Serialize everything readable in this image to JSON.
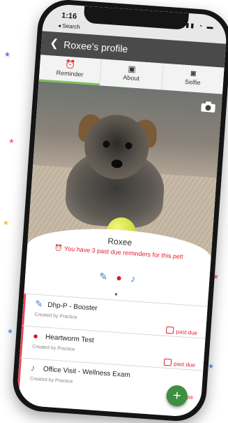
{
  "status_bar": {
    "time": "1:16",
    "back_hint": "◂ Search",
    "icons": "▮▮▮ ◔ ▬"
  },
  "header": {
    "back_icon": "chevron-left",
    "title": "Roxee's profile"
  },
  "tabs": [
    {
      "label": "Reminder",
      "icon": "alarm-clock",
      "active": true
    },
    {
      "label": "About",
      "icon": "id-card",
      "active": false
    },
    {
      "label": "Selfie",
      "icon": "camera",
      "active": false
    }
  ],
  "pet": {
    "name": "Roxee",
    "alert": "You have 3 past due reminders for this pet!"
  },
  "reminders": [
    {
      "title": "Dhp-P - Booster",
      "sub": "Created by Practice",
      "status": "past due",
      "icon": "syringe"
    },
    {
      "title": "Heartworm Test",
      "sub": "Created by Practice",
      "status": "past due",
      "icon": "blood-drop"
    },
    {
      "title": "Office Visit - Wellness Exam",
      "sub": "Created by Practice",
      "status": "pa",
      "icon": "stethoscope"
    }
  ],
  "colors": {
    "accent": "#e0202e",
    "tab_active": "#7cc05a",
    "fab": "#3e8f3f"
  }
}
